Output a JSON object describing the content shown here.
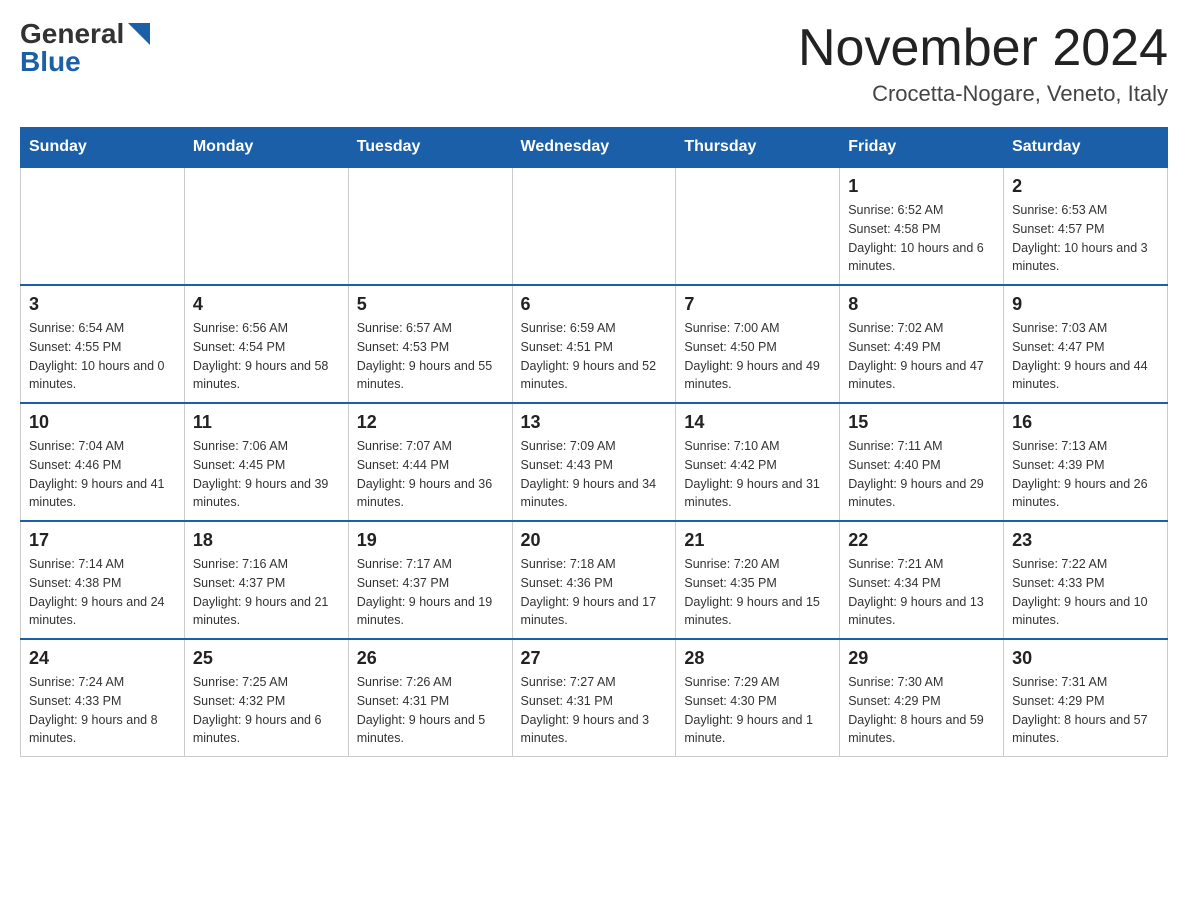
{
  "header": {
    "logo_general": "General",
    "logo_blue": "Blue",
    "title": "November 2024",
    "location": "Crocetta-Nogare, Veneto, Italy"
  },
  "days_of_week": [
    "Sunday",
    "Monday",
    "Tuesday",
    "Wednesday",
    "Thursday",
    "Friday",
    "Saturday"
  ],
  "weeks": [
    [
      {
        "day": "",
        "info": ""
      },
      {
        "day": "",
        "info": ""
      },
      {
        "day": "",
        "info": ""
      },
      {
        "day": "",
        "info": ""
      },
      {
        "day": "",
        "info": ""
      },
      {
        "day": "1",
        "info": "Sunrise: 6:52 AM\nSunset: 4:58 PM\nDaylight: 10 hours and 6 minutes."
      },
      {
        "day": "2",
        "info": "Sunrise: 6:53 AM\nSunset: 4:57 PM\nDaylight: 10 hours and 3 minutes."
      }
    ],
    [
      {
        "day": "3",
        "info": "Sunrise: 6:54 AM\nSunset: 4:55 PM\nDaylight: 10 hours and 0 minutes."
      },
      {
        "day": "4",
        "info": "Sunrise: 6:56 AM\nSunset: 4:54 PM\nDaylight: 9 hours and 58 minutes."
      },
      {
        "day": "5",
        "info": "Sunrise: 6:57 AM\nSunset: 4:53 PM\nDaylight: 9 hours and 55 minutes."
      },
      {
        "day": "6",
        "info": "Sunrise: 6:59 AM\nSunset: 4:51 PM\nDaylight: 9 hours and 52 minutes."
      },
      {
        "day": "7",
        "info": "Sunrise: 7:00 AM\nSunset: 4:50 PM\nDaylight: 9 hours and 49 minutes."
      },
      {
        "day": "8",
        "info": "Sunrise: 7:02 AM\nSunset: 4:49 PM\nDaylight: 9 hours and 47 minutes."
      },
      {
        "day": "9",
        "info": "Sunrise: 7:03 AM\nSunset: 4:47 PM\nDaylight: 9 hours and 44 minutes."
      }
    ],
    [
      {
        "day": "10",
        "info": "Sunrise: 7:04 AM\nSunset: 4:46 PM\nDaylight: 9 hours and 41 minutes."
      },
      {
        "day": "11",
        "info": "Sunrise: 7:06 AM\nSunset: 4:45 PM\nDaylight: 9 hours and 39 minutes."
      },
      {
        "day": "12",
        "info": "Sunrise: 7:07 AM\nSunset: 4:44 PM\nDaylight: 9 hours and 36 minutes."
      },
      {
        "day": "13",
        "info": "Sunrise: 7:09 AM\nSunset: 4:43 PM\nDaylight: 9 hours and 34 minutes."
      },
      {
        "day": "14",
        "info": "Sunrise: 7:10 AM\nSunset: 4:42 PM\nDaylight: 9 hours and 31 minutes."
      },
      {
        "day": "15",
        "info": "Sunrise: 7:11 AM\nSunset: 4:40 PM\nDaylight: 9 hours and 29 minutes."
      },
      {
        "day": "16",
        "info": "Sunrise: 7:13 AM\nSunset: 4:39 PM\nDaylight: 9 hours and 26 minutes."
      }
    ],
    [
      {
        "day": "17",
        "info": "Sunrise: 7:14 AM\nSunset: 4:38 PM\nDaylight: 9 hours and 24 minutes."
      },
      {
        "day": "18",
        "info": "Sunrise: 7:16 AM\nSunset: 4:37 PM\nDaylight: 9 hours and 21 minutes."
      },
      {
        "day": "19",
        "info": "Sunrise: 7:17 AM\nSunset: 4:37 PM\nDaylight: 9 hours and 19 minutes."
      },
      {
        "day": "20",
        "info": "Sunrise: 7:18 AM\nSunset: 4:36 PM\nDaylight: 9 hours and 17 minutes."
      },
      {
        "day": "21",
        "info": "Sunrise: 7:20 AM\nSunset: 4:35 PM\nDaylight: 9 hours and 15 minutes."
      },
      {
        "day": "22",
        "info": "Sunrise: 7:21 AM\nSunset: 4:34 PM\nDaylight: 9 hours and 13 minutes."
      },
      {
        "day": "23",
        "info": "Sunrise: 7:22 AM\nSunset: 4:33 PM\nDaylight: 9 hours and 10 minutes."
      }
    ],
    [
      {
        "day": "24",
        "info": "Sunrise: 7:24 AM\nSunset: 4:33 PM\nDaylight: 9 hours and 8 minutes."
      },
      {
        "day": "25",
        "info": "Sunrise: 7:25 AM\nSunset: 4:32 PM\nDaylight: 9 hours and 6 minutes."
      },
      {
        "day": "26",
        "info": "Sunrise: 7:26 AM\nSunset: 4:31 PM\nDaylight: 9 hours and 5 minutes."
      },
      {
        "day": "27",
        "info": "Sunrise: 7:27 AM\nSunset: 4:31 PM\nDaylight: 9 hours and 3 minutes."
      },
      {
        "day": "28",
        "info": "Sunrise: 7:29 AM\nSunset: 4:30 PM\nDaylight: 9 hours and 1 minute."
      },
      {
        "day": "29",
        "info": "Sunrise: 7:30 AM\nSunset: 4:29 PM\nDaylight: 8 hours and 59 minutes."
      },
      {
        "day": "30",
        "info": "Sunrise: 7:31 AM\nSunset: 4:29 PM\nDaylight: 8 hours and 57 minutes."
      }
    ]
  ]
}
